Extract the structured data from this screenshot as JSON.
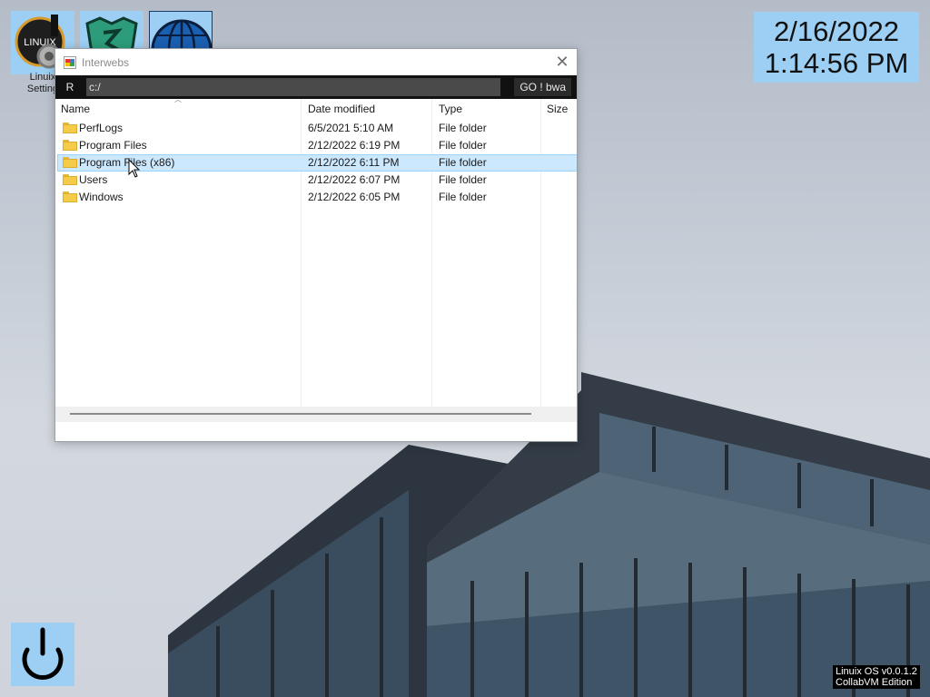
{
  "desktop": {
    "icons": [
      {
        "label_line1": "Linuix",
        "label_line2": "Setting",
        "icon": "linuix-settings-gear-icon",
        "selected": true
      },
      {
        "label_line1": "",
        "label_line2": "",
        "icon": "green-shield-app-icon",
        "selected": true
      },
      {
        "label_line1": "",
        "label_line2": "",
        "icon": "globe-icon",
        "selected": true
      }
    ]
  },
  "clock": {
    "date": "2/16/2022",
    "time": "1:14:56 PM"
  },
  "window": {
    "title": "Interwebs",
    "toolbar": {
      "r_label": "R",
      "path_value": "c:/",
      "go_label": "GO ! bwa"
    },
    "columns": [
      "Name",
      "Date modified",
      "Type",
      "Size"
    ],
    "rows": [
      {
        "name": "PerfLogs",
        "date": "6/5/2021 5:10 AM",
        "type": "File folder",
        "size": ""
      },
      {
        "name": "Program Files",
        "date": "2/12/2022 6:19 PM",
        "type": "File folder",
        "size": ""
      },
      {
        "name": "Program Files (x86)",
        "date": "2/12/2022 6:11 PM",
        "type": "File folder",
        "size": "",
        "selected": true
      },
      {
        "name": "Users",
        "date": "2/12/2022 6:07 PM",
        "type": "File folder",
        "size": ""
      },
      {
        "name": "Windows",
        "date": "2/12/2022 6:05 PM",
        "type": "File folder",
        "size": ""
      }
    ]
  },
  "os_label": {
    "line1": "Linuix OS v0.0.1.2",
    "line2": "CollabVM Edition"
  },
  "colors": {
    "accent": "#9ccff3",
    "selection": "#cce8ff",
    "toolbar": "#111111"
  }
}
